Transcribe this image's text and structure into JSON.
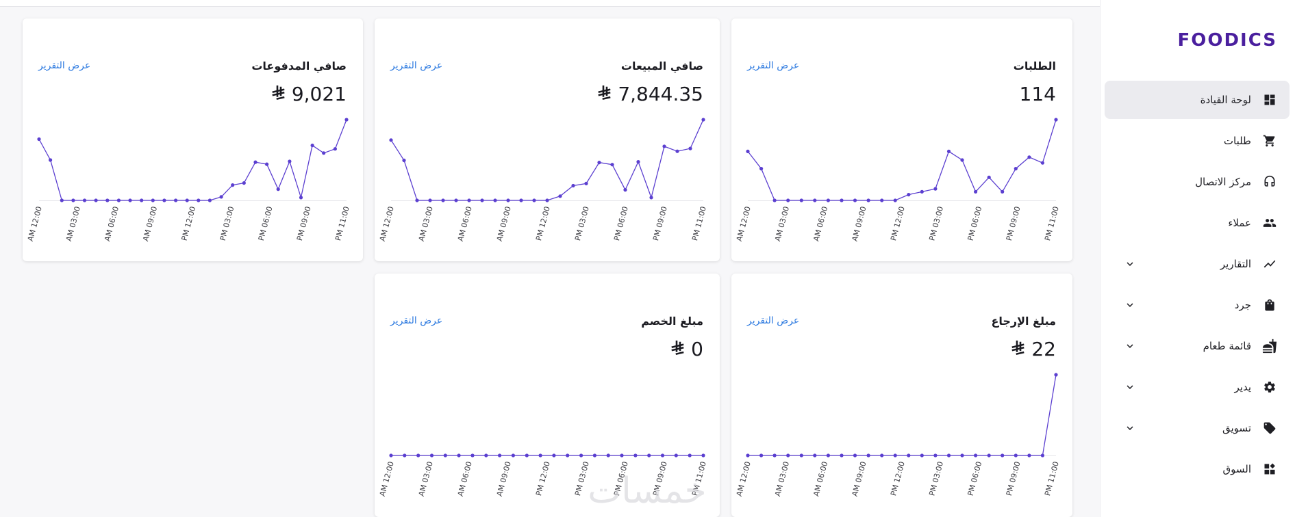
{
  "brand": {
    "logo_text": "FOODICS",
    "accent": "#4a1f9e",
    "link_color": "#2d7ae0",
    "line_color": "#5b3fd0"
  },
  "sidebar": {
    "items": [
      {
        "label": "لوحة القيادة",
        "icon": "dashboard-icon",
        "active": true,
        "expandable": false
      },
      {
        "label": "طلبات",
        "icon": "cart-icon",
        "active": false,
        "expandable": false
      },
      {
        "label": "مركز الاتصال",
        "icon": "headset-icon",
        "active": false,
        "expandable": false
      },
      {
        "label": "عملاء",
        "icon": "people-icon",
        "active": false,
        "expandable": false
      },
      {
        "label": "التقارير",
        "icon": "trend-icon",
        "active": false,
        "expandable": true
      },
      {
        "label": "جرد",
        "icon": "bag-icon",
        "active": false,
        "expandable": true
      },
      {
        "label": "قائمة طعام",
        "icon": "food-menu-icon",
        "active": false,
        "expandable": true
      },
      {
        "label": "يدير",
        "icon": "gear-icon",
        "active": false,
        "expandable": true
      },
      {
        "label": "تسويق",
        "icon": "tag-icon",
        "active": false,
        "expandable": true
      },
      {
        "label": "السوق",
        "icon": "marketplace-icon",
        "active": false,
        "expandable": false
      }
    ]
  },
  "x_ticks": [
    "AM 12:00",
    "AM 03:00",
    "AM 06:00",
    "AM 09:00",
    "PM 12:00",
    "PM 03:00",
    "PM 06:00",
    "PM 09:00",
    "PM 11:00"
  ],
  "cards": [
    {
      "title": "الطلبات",
      "link": "عرض التقرير",
      "value": "114",
      "currency": false
    },
    {
      "title": "صافي المبيعات",
      "link": "عرض التقرير",
      "value": "7,844.35",
      "currency": true
    },
    {
      "title": "صافي المدفوعات",
      "link": "عرض التقرير",
      "value": "9,021",
      "currency": true
    },
    {
      "title": "مبلغ الإرجاع",
      "link": "عرض التقرير",
      "value": "22",
      "currency": true
    },
    {
      "title": "مبلغ الخصم",
      "link": "عرض التقرير",
      "value": "0",
      "currency": true
    }
  ],
  "chart_data": [
    {
      "type": "line",
      "series": [
        {
          "values": [
            17,
            11,
            0,
            0,
            0,
            0,
            0,
            0,
            0,
            0,
            0,
            0,
            2,
            3,
            4,
            17,
            14,
            3,
            8,
            3,
            11,
            15,
            13,
            28
          ]
        }
      ]
    },
    {
      "type": "line",
      "series": [
        {
          "values": [
            860,
            570,
            0,
            0,
            0,
            0,
            0,
            0,
            0,
            0,
            0,
            0,
            0,
            60,
            210,
            240,
            540,
            510,
            150,
            550,
            40,
            770,
            700,
            740,
            1150
          ]
        }
      ]
    },
    {
      "type": "line",
      "series": [
        {
          "values": [
            880,
            580,
            0,
            0,
            0,
            0,
            0,
            0,
            0,
            0,
            0,
            0,
            0,
            0,
            0,
            0,
            50,
            220,
            250,
            550,
            520,
            160,
            560,
            40,
            790,
            680,
            740,
            1160
          ]
        }
      ]
    },
    {
      "type": "line",
      "series": [
        {
          "values": [
            0,
            0,
            0,
            0,
            0,
            0,
            0,
            0,
            0,
            0,
            0,
            0,
            0,
            0,
            0,
            0,
            0,
            0,
            0,
            0,
            0,
            0,
            0,
            22
          ]
        }
      ]
    },
    {
      "type": "line",
      "series": [
        {
          "values": [
            0,
            0,
            0,
            0,
            0,
            0,
            0,
            0,
            0,
            0,
            0,
            0,
            0,
            0,
            0,
            0,
            0,
            0,
            0,
            0,
            0,
            0,
            0,
            0
          ]
        }
      ]
    }
  ],
  "watermark_text": "خمسات"
}
